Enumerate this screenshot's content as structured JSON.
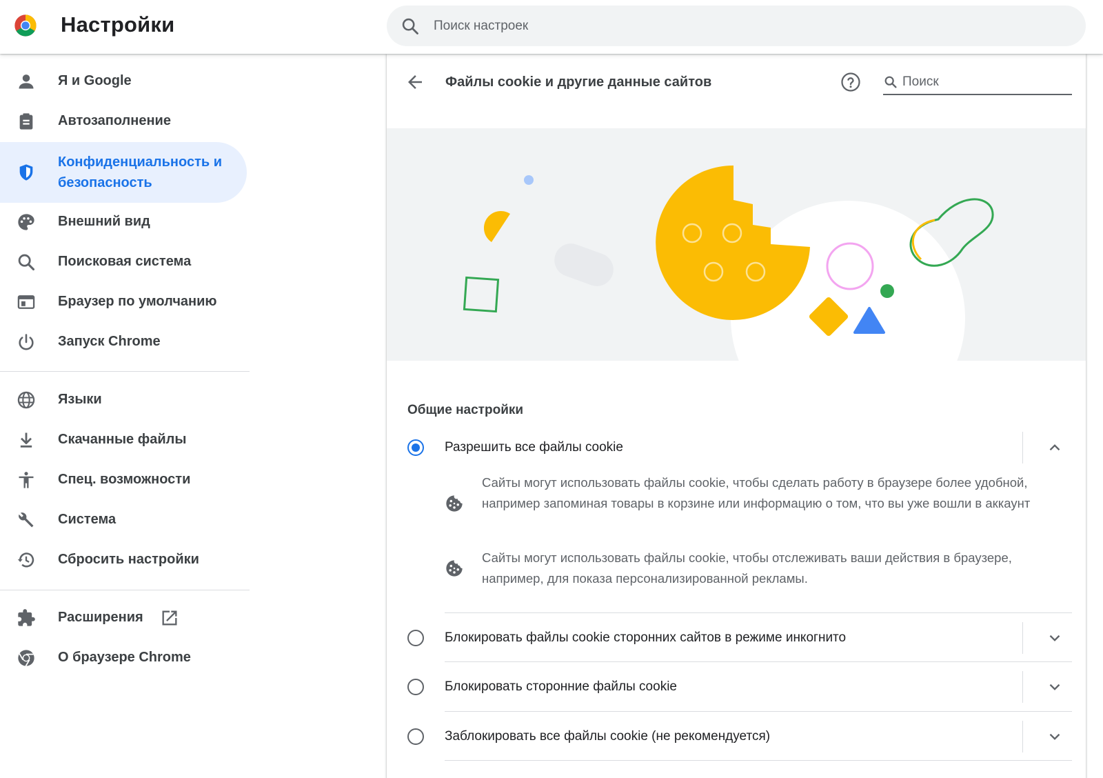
{
  "header": {
    "title": "Настройки",
    "search_placeholder": "Поиск настроек"
  },
  "sidebar": {
    "items": [
      {
        "label": "Я и Google",
        "icon": "person-icon"
      },
      {
        "label": "Автозаполнение",
        "icon": "clipboard-icon"
      },
      {
        "label": "Конфиденциальность и безопасность",
        "icon": "shield-icon",
        "active": true
      },
      {
        "label": "Внешний вид",
        "icon": "palette-icon"
      },
      {
        "label": "Поисковая система",
        "icon": "search-icon"
      },
      {
        "label": "Браузер по умолчанию",
        "icon": "browser-window-icon"
      },
      {
        "label": "Запуск Chrome",
        "icon": "power-icon"
      },
      {
        "label": "Языки",
        "icon": "globe-icon"
      },
      {
        "label": "Скачанные файлы",
        "icon": "download-icon"
      },
      {
        "label": "Спец. возможности",
        "icon": "accessibility-icon"
      },
      {
        "label": "Система",
        "icon": "wrench-icon"
      },
      {
        "label": "Сбросить настройки",
        "icon": "restore-icon"
      },
      {
        "label": "Расширения",
        "icon": "puzzle-icon"
      },
      {
        "label": "О браузере Chrome",
        "icon": "chrome-icon"
      }
    ]
  },
  "content": {
    "page_title": "Файлы cookie и другие данные сайтов",
    "search_placeholder": "Поиск",
    "section_title": "Общие настройки",
    "options": [
      {
        "label": "Разрешить все файлы cookie",
        "selected": true,
        "expanded": true
      },
      {
        "label": "Блокировать файлы cookie сторонних сайтов в режиме инкогнито",
        "selected": false,
        "expanded": false
      },
      {
        "label": "Блокировать сторонние файлы cookie",
        "selected": false,
        "expanded": false
      },
      {
        "label": "Заблокировать все файлы cookie (не рекомендуется)",
        "selected": false,
        "expanded": false
      }
    ],
    "details": [
      "Сайты могут использовать файлы cookie, чтобы сделать работу в браузере более удобной, например запоминая товары в корзине или информацию о том, что вы уже вошли в аккаунт",
      "Сайты могут использовать файлы cookie, чтобы отслеживать ваши действия в браузере, например, для показа персонализированной рекламы."
    ]
  },
  "colors": {
    "accent": "#1a73e8",
    "active_bg": "#e8f0fe",
    "cookie_yellow": "#fbbc04",
    "green": "#34a853",
    "blue": "#4285f4",
    "pink": "#f3a5f0"
  }
}
